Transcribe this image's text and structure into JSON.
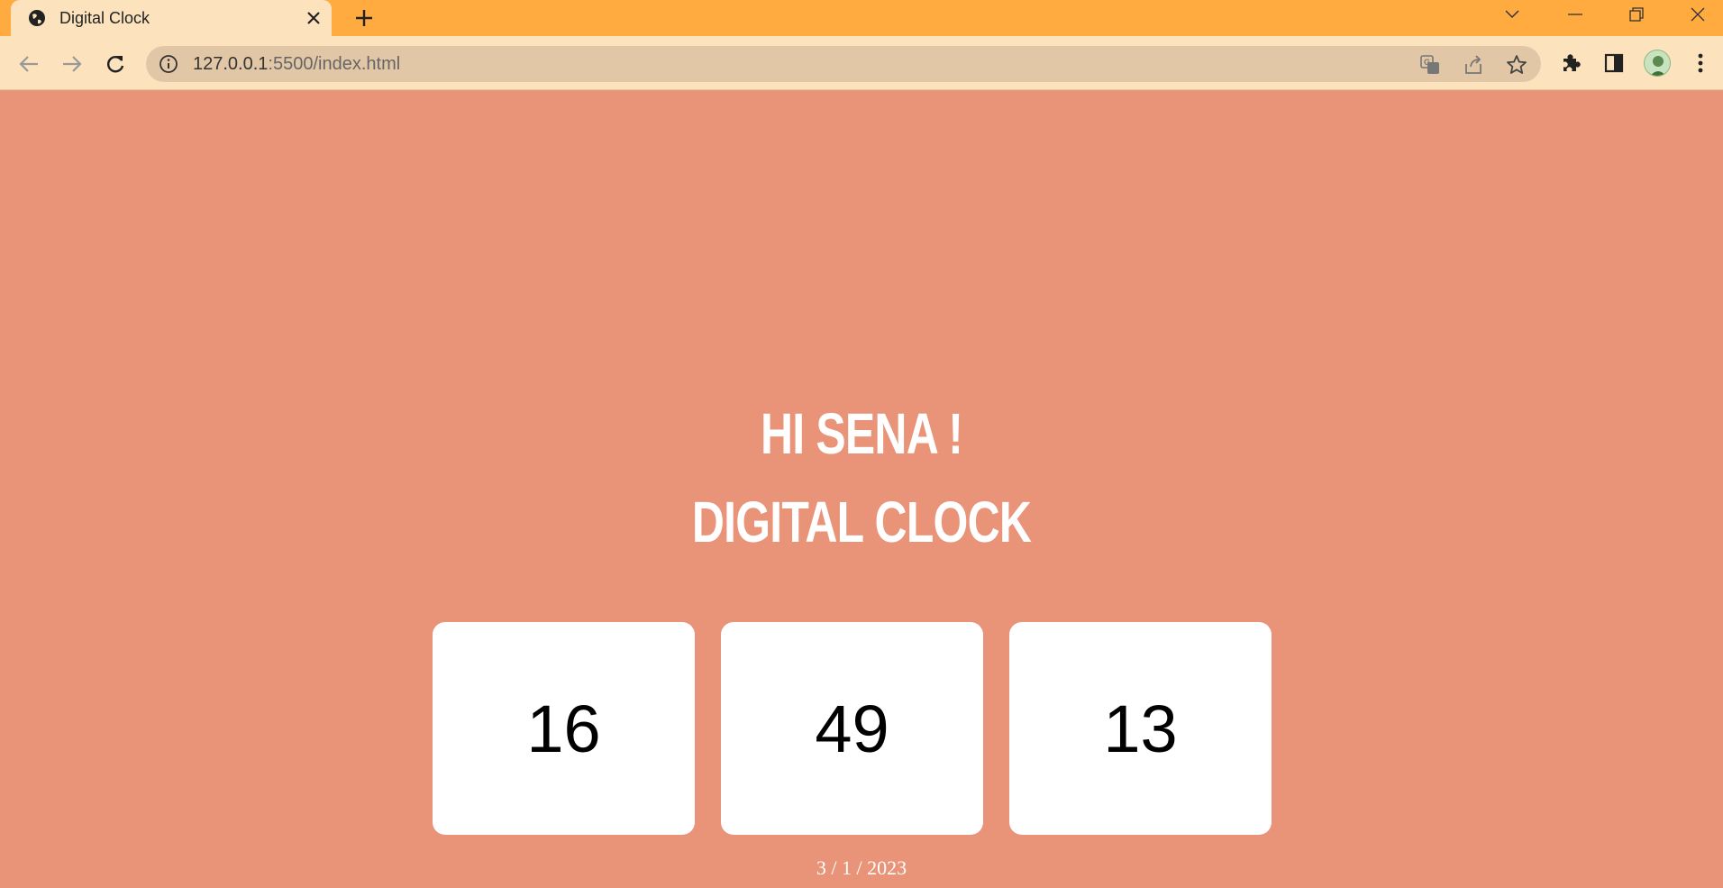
{
  "browser": {
    "tab_title": "Digital Clock",
    "url_host": "127.0.0.1",
    "url_path": ":5500/index.html",
    "titlebar_color": "#ffab40",
    "toolbar_color": "#fde3bd"
  },
  "icons": {
    "tab": "globe-icon",
    "close": "close-icon",
    "new_tab": "plus-icon",
    "back": "back-arrow-icon",
    "forward": "forward-arrow-icon",
    "reload": "reload-icon",
    "site_info": "info-icon",
    "translate": "translate-icon",
    "share": "share-icon",
    "bookmark": "star-icon",
    "extensions": "puzzle-icon",
    "side_panel": "side-panel-icon",
    "menu": "kebab-menu-icon"
  },
  "page": {
    "background": "#e99478",
    "greeting": "HI SENA !",
    "title": "DIGITAL CLOCK",
    "hours": "16",
    "minutes": "49",
    "seconds": "13",
    "date": "3 / 1 / 2023"
  }
}
